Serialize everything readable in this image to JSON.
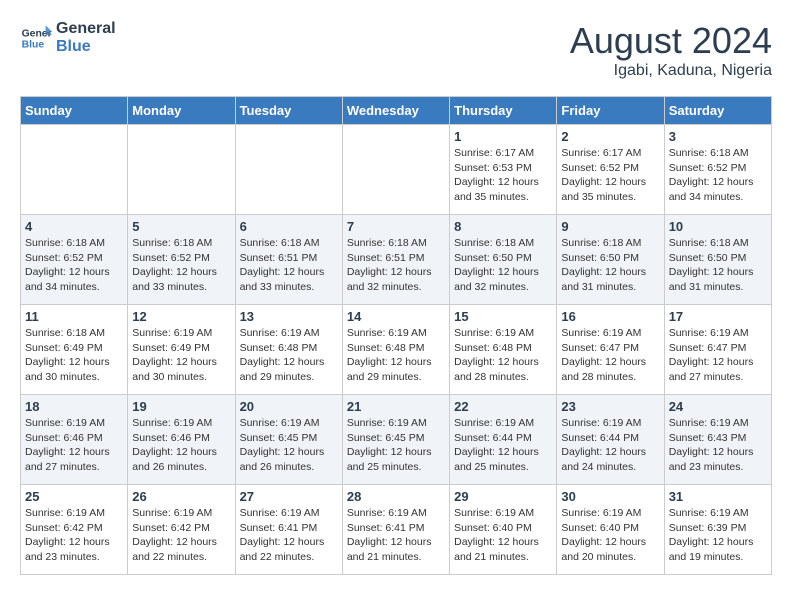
{
  "header": {
    "logo_line1": "General",
    "logo_line2": "Blue",
    "month_year": "August 2024",
    "location": "Igabi, Kaduna, Nigeria"
  },
  "days_of_week": [
    "Sunday",
    "Monday",
    "Tuesday",
    "Wednesday",
    "Thursday",
    "Friday",
    "Saturday"
  ],
  "weeks": [
    [
      {
        "day": "",
        "info": ""
      },
      {
        "day": "",
        "info": ""
      },
      {
        "day": "",
        "info": ""
      },
      {
        "day": "",
        "info": ""
      },
      {
        "day": "1",
        "info": "Sunrise: 6:17 AM\nSunset: 6:53 PM\nDaylight: 12 hours and 35 minutes."
      },
      {
        "day": "2",
        "info": "Sunrise: 6:17 AM\nSunset: 6:52 PM\nDaylight: 12 hours and 35 minutes."
      },
      {
        "day": "3",
        "info": "Sunrise: 6:18 AM\nSunset: 6:52 PM\nDaylight: 12 hours and 34 minutes."
      }
    ],
    [
      {
        "day": "4",
        "info": "Sunrise: 6:18 AM\nSunset: 6:52 PM\nDaylight: 12 hours and 34 minutes."
      },
      {
        "day": "5",
        "info": "Sunrise: 6:18 AM\nSunset: 6:52 PM\nDaylight: 12 hours and 33 minutes."
      },
      {
        "day": "6",
        "info": "Sunrise: 6:18 AM\nSunset: 6:51 PM\nDaylight: 12 hours and 33 minutes."
      },
      {
        "day": "7",
        "info": "Sunrise: 6:18 AM\nSunset: 6:51 PM\nDaylight: 12 hours and 32 minutes."
      },
      {
        "day": "8",
        "info": "Sunrise: 6:18 AM\nSunset: 6:50 PM\nDaylight: 12 hours and 32 minutes."
      },
      {
        "day": "9",
        "info": "Sunrise: 6:18 AM\nSunset: 6:50 PM\nDaylight: 12 hours and 31 minutes."
      },
      {
        "day": "10",
        "info": "Sunrise: 6:18 AM\nSunset: 6:50 PM\nDaylight: 12 hours and 31 minutes."
      }
    ],
    [
      {
        "day": "11",
        "info": "Sunrise: 6:18 AM\nSunset: 6:49 PM\nDaylight: 12 hours and 30 minutes."
      },
      {
        "day": "12",
        "info": "Sunrise: 6:19 AM\nSunset: 6:49 PM\nDaylight: 12 hours and 30 minutes."
      },
      {
        "day": "13",
        "info": "Sunrise: 6:19 AM\nSunset: 6:48 PM\nDaylight: 12 hours and 29 minutes."
      },
      {
        "day": "14",
        "info": "Sunrise: 6:19 AM\nSunset: 6:48 PM\nDaylight: 12 hours and 29 minutes."
      },
      {
        "day": "15",
        "info": "Sunrise: 6:19 AM\nSunset: 6:48 PM\nDaylight: 12 hours and 28 minutes."
      },
      {
        "day": "16",
        "info": "Sunrise: 6:19 AM\nSunset: 6:47 PM\nDaylight: 12 hours and 28 minutes."
      },
      {
        "day": "17",
        "info": "Sunrise: 6:19 AM\nSunset: 6:47 PM\nDaylight: 12 hours and 27 minutes."
      }
    ],
    [
      {
        "day": "18",
        "info": "Sunrise: 6:19 AM\nSunset: 6:46 PM\nDaylight: 12 hours and 27 minutes."
      },
      {
        "day": "19",
        "info": "Sunrise: 6:19 AM\nSunset: 6:46 PM\nDaylight: 12 hours and 26 minutes."
      },
      {
        "day": "20",
        "info": "Sunrise: 6:19 AM\nSunset: 6:45 PM\nDaylight: 12 hours and 26 minutes."
      },
      {
        "day": "21",
        "info": "Sunrise: 6:19 AM\nSunset: 6:45 PM\nDaylight: 12 hours and 25 minutes."
      },
      {
        "day": "22",
        "info": "Sunrise: 6:19 AM\nSunset: 6:44 PM\nDaylight: 12 hours and 25 minutes."
      },
      {
        "day": "23",
        "info": "Sunrise: 6:19 AM\nSunset: 6:44 PM\nDaylight: 12 hours and 24 minutes."
      },
      {
        "day": "24",
        "info": "Sunrise: 6:19 AM\nSunset: 6:43 PM\nDaylight: 12 hours and 23 minutes."
      }
    ],
    [
      {
        "day": "25",
        "info": "Sunrise: 6:19 AM\nSunset: 6:42 PM\nDaylight: 12 hours and 23 minutes."
      },
      {
        "day": "26",
        "info": "Sunrise: 6:19 AM\nSunset: 6:42 PM\nDaylight: 12 hours and 22 minutes."
      },
      {
        "day": "27",
        "info": "Sunrise: 6:19 AM\nSunset: 6:41 PM\nDaylight: 12 hours and 22 minutes."
      },
      {
        "day": "28",
        "info": "Sunrise: 6:19 AM\nSunset: 6:41 PM\nDaylight: 12 hours and 21 minutes."
      },
      {
        "day": "29",
        "info": "Sunrise: 6:19 AM\nSunset: 6:40 PM\nDaylight: 12 hours and 21 minutes."
      },
      {
        "day": "30",
        "info": "Sunrise: 6:19 AM\nSunset: 6:40 PM\nDaylight: 12 hours and 20 minutes."
      },
      {
        "day": "31",
        "info": "Sunrise: 6:19 AM\nSunset: 6:39 PM\nDaylight: 12 hours and 19 minutes."
      }
    ]
  ]
}
